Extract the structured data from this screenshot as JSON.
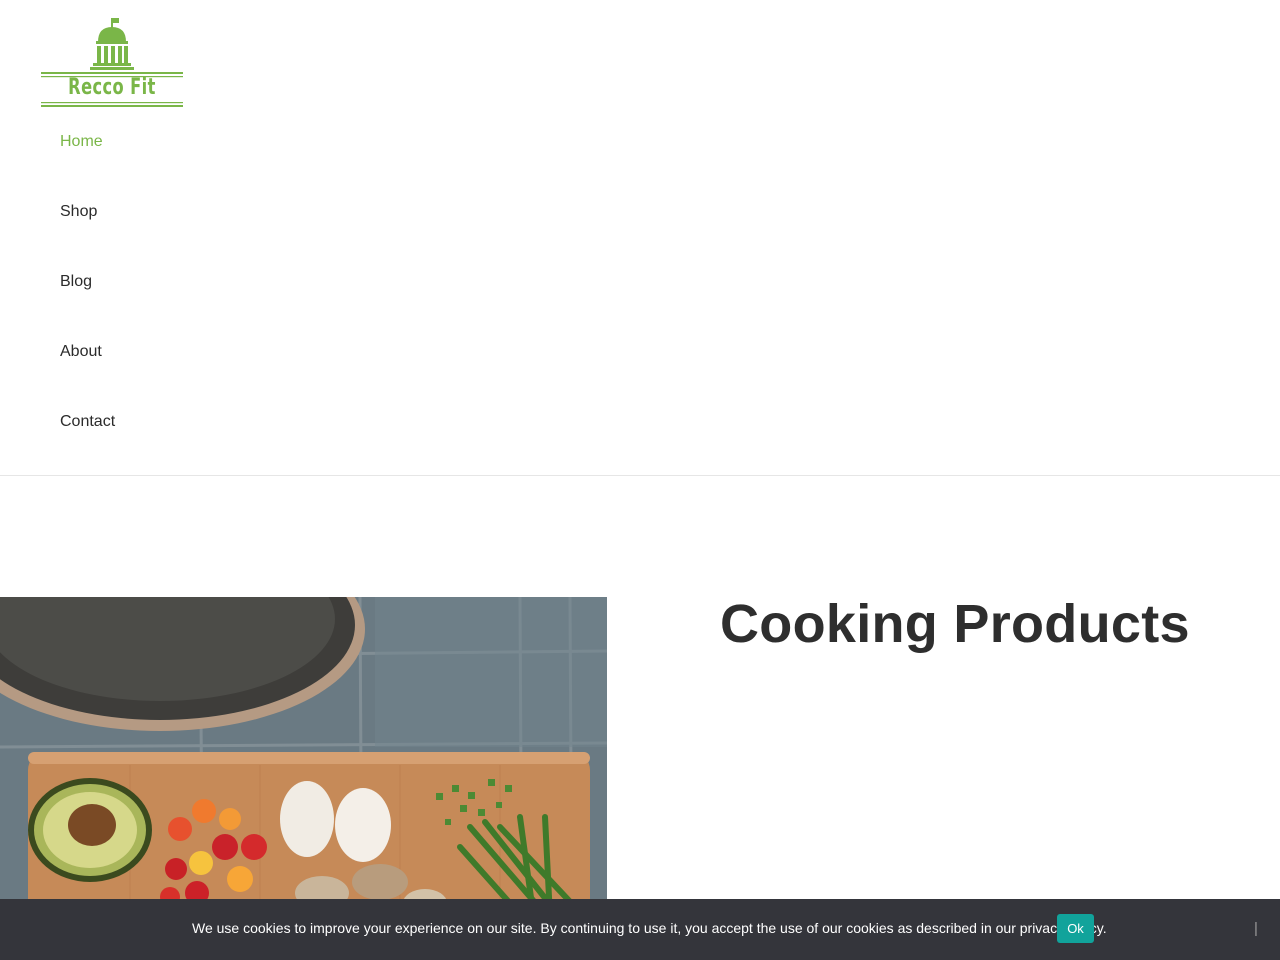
{
  "brand": {
    "name": "Recco Fit",
    "logo_icon": "building-icon",
    "accent_color": "#7ab648"
  },
  "nav": {
    "items": [
      {
        "label": "Home",
        "active": true
      },
      {
        "label": "Shop",
        "active": false
      },
      {
        "label": "Blog",
        "active": false
      },
      {
        "label": "About",
        "active": false
      },
      {
        "label": "Contact",
        "active": false
      }
    ]
  },
  "hero": {
    "title": "Cooking Products",
    "image_subject": "frying pan and cutting board with avocado, tomatoes, eggs, mushrooms and green onions"
  },
  "cookie_bar": {
    "message": "We use cookies to improve your experience on our site. By continuing to use it, you accept the use of our cookies as described in our privacy policy.",
    "ok_label": "Ok",
    "close_icon": "close-icon",
    "background_color": "#34353b",
    "button_color": "#11a39b"
  }
}
